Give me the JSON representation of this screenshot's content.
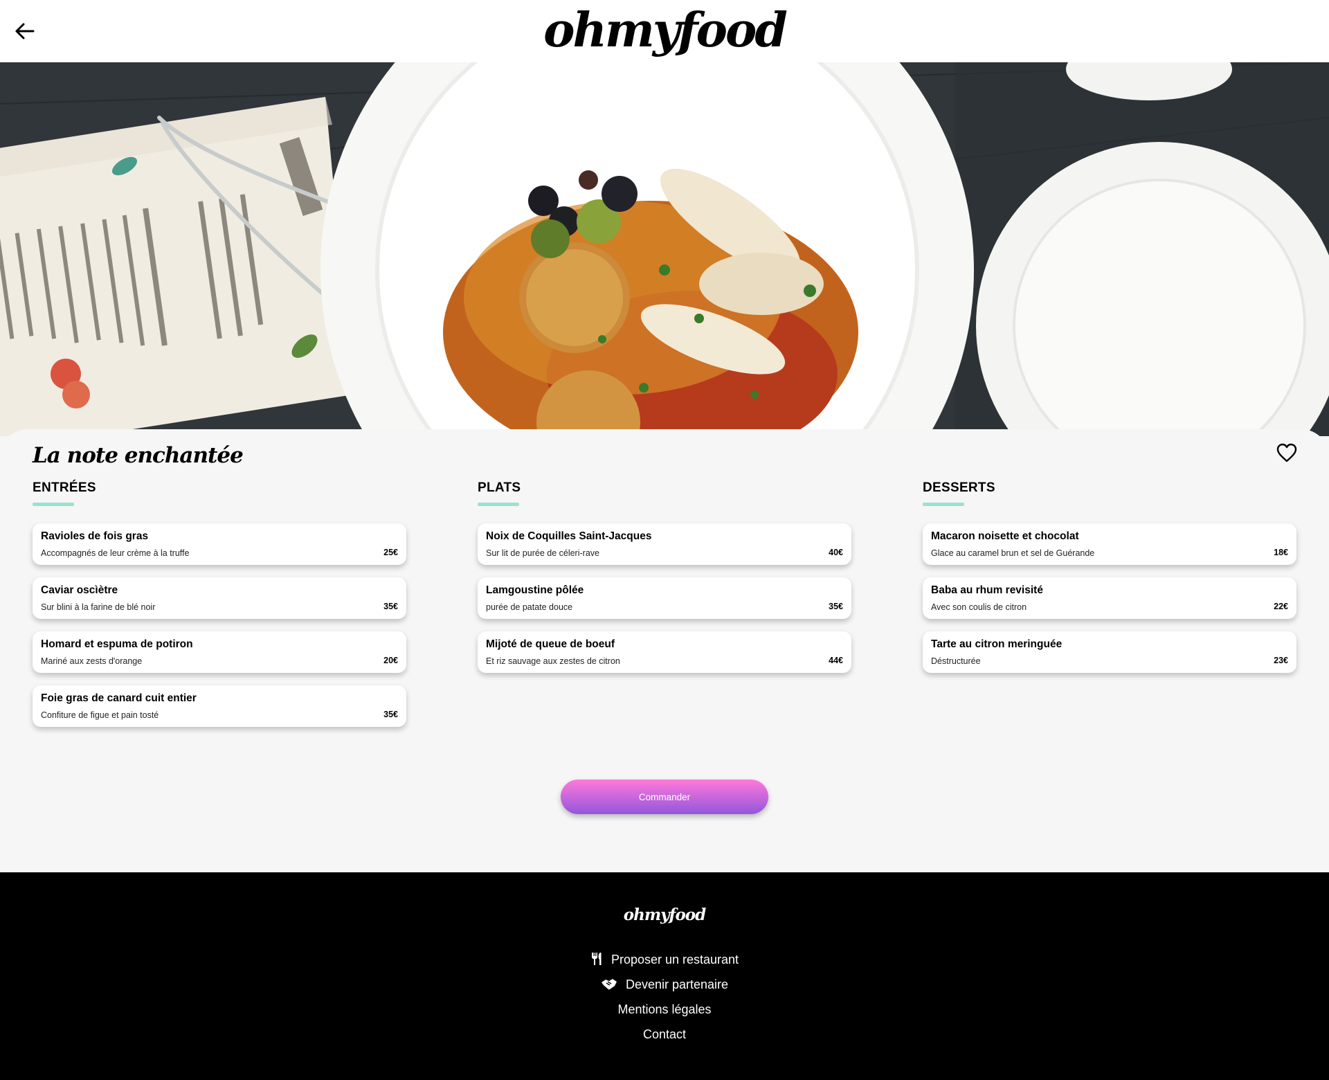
{
  "header": {
    "back_icon": "arrow-left-icon",
    "logo": "ohmyfood"
  },
  "hero": {
    "image": "food-plate-photo"
  },
  "restaurant": {
    "name": "La note enchantée",
    "favorite_icon": "heart-icon"
  },
  "menu": {
    "entrees": {
      "heading": "ENTRÉES",
      "items": [
        {
          "name": "Ravioles de fois gras",
          "description": "Accompagnés de leur crème à la truffe",
          "price": "25€"
        },
        {
          "name": "Caviar oscìètre",
          "description": "Sur blini à la farine de blé noir",
          "price": "35€"
        },
        {
          "name": "Homard et espuma de potiron",
          "description": "Mariné aux zests d'orange",
          "price": "20€"
        },
        {
          "name": "Foie gras de canard cuit entier",
          "description": "Confiture de figue et pain tosté",
          "price": "35€"
        }
      ]
    },
    "plats": {
      "heading": "PLATS",
      "items": [
        {
          "name": "Noix de Coquilles Saint-Jacques",
          "description": "Sur lit de purée de céleri-rave",
          "price": "40€"
        },
        {
          "name": "Lamgoustine pôlée",
          "description": "purée de patate douce",
          "price": "35€"
        },
        {
          "name": "Mijoté de queue de boeuf",
          "description": "Et riz sauvage aux zestes de citron",
          "price": "44€"
        }
      ]
    },
    "desserts": {
      "heading": "DESSERTS",
      "items": [
        {
          "name": "Macaron noisette et chocolat",
          "description": "Glace au caramel brun et sel de Guérande",
          "price": "18€"
        },
        {
          "name": "Baba au rhum revisité",
          "description": "Avec son coulis de citron",
          "price": "22€"
        },
        {
          "name": "Tarte au citron meringuée",
          "description": "Déstructurée",
          "price": "23€"
        }
      ]
    }
  },
  "order_button": "Commander",
  "footer": {
    "logo": "ohmyfood",
    "links": [
      {
        "label": "Proposer un restaurant",
        "icon": "utensils-icon"
      },
      {
        "label": "Devenir partenaire",
        "icon": "handshake-icon"
      },
      {
        "label": "Mentions légales"
      },
      {
        "label": "Contact"
      }
    ]
  },
  "colors": {
    "accent_underline": "#99e2d0",
    "button_gradient_top": "#ff79da",
    "button_gradient_bottom": "#9356dc",
    "footer_bg": "#000000",
    "page_bg": "#f6f6f6"
  }
}
